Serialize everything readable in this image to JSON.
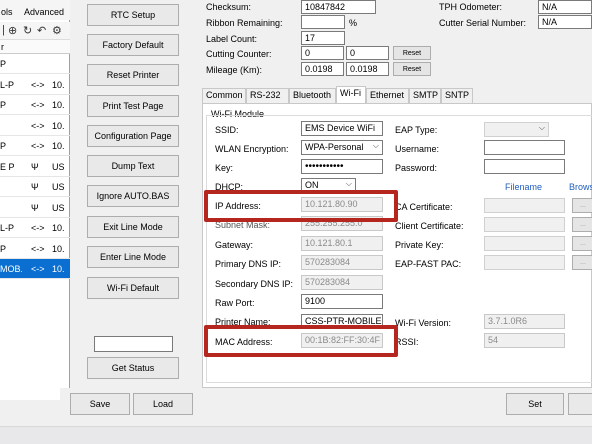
{
  "left_panel": {
    "menu": [
      "ols",
      "Advanced"
    ],
    "toolbar_icons": [
      "connect-icon",
      "refresh-icon",
      "back-icon",
      "gear-icon"
    ],
    "header": "r",
    "rows": [
      {
        "c1": "P",
        "c2": "",
        "c3": ""
      },
      {
        "c1": "L-P",
        "c2": "<->",
        "c3": "10."
      },
      {
        "c1": "P",
        "c2": "<->",
        "c3": "10."
      },
      {
        "c1": "",
        "c2": "<->",
        "c3": "10."
      },
      {
        "c1": "P",
        "c2": "<->",
        "c3": "10."
      },
      {
        "c1": "E P",
        "c2": "Ψ",
        "c3": "US"
      },
      {
        "c1": "",
        "c2": "Ψ",
        "c3": "US"
      },
      {
        "c1": "",
        "c2": "Ψ",
        "c3": "US"
      },
      {
        "c1": "L-P",
        "c2": "<->",
        "c3": "10."
      },
      {
        "c1": "P",
        "c2": "<->",
        "c3": "10."
      },
      {
        "c1": "MOB..",
        "c2": "<->",
        "c3": "10."
      }
    ],
    "selected_row": 10
  },
  "side_buttons": {
    "rtc_setup": "RTC Setup",
    "factory_default": "Factory Default",
    "reset_printer": "Reset Printer",
    "print_test_page": "Print Test Page",
    "configuration_page": "Configuration Page",
    "dump_text": "Dump Text",
    "ignore_auto_bas": "Ignore AUTO.BAS",
    "exit_line_mode": "Exit Line Mode",
    "enter_line_mode": "Enter Line Mode",
    "wifi_default": "Wi-Fi Default",
    "status_value": "",
    "get_status": "Get Status"
  },
  "info": {
    "checksum_label": "Checksum:",
    "checksum_value": "10847842",
    "ribbon_label": "Ribbon Remaining:",
    "ribbon_value": "",
    "ribbon_unit": "%",
    "label_count_label": "Label Count:",
    "label_count_value": "17",
    "cutting_label": "Cutting Counter:",
    "cutting_value1": "0",
    "cutting_value2": "0",
    "mileage_label": "Mileage (Km):",
    "mileage_value1": "0.0198",
    "mileage_value2": "0.0198",
    "reset_label": "Reset",
    "tph_label": "TPH Odometer:",
    "tph_value": "N/A",
    "cutter_serial_label": "Cutter Serial Number:",
    "cutter_serial_value": "N/A"
  },
  "tabs": [
    "Common",
    "RS-232",
    "Bluetooth",
    "Wi-Fi",
    "Ethernet",
    "SMTP",
    "SNTP"
  ],
  "active_tab": "Wi-Fi",
  "wifi": {
    "group_title": "Wi-Fi Module",
    "ssid_label": "SSID:",
    "ssid_value": "EMS Device WiFi",
    "wlan_label": "WLAN Encryption:",
    "wlan_value": "WPA-Personal",
    "key_label": "Key:",
    "key_value": "•••••••••••",
    "dhcp_label": "DHCP:",
    "dhcp_value": "ON",
    "ip_label": "IP Address:",
    "ip_value": "10.121.80.90",
    "subnet_label": "Subnet Mask:",
    "subnet_value": "255.255.255.0",
    "gateway_label": "Gateway:",
    "gateway_value": "10.121.80.1",
    "pdns_label": "Primary DNS IP:",
    "pdns_value": "570283084",
    "sdns_label": "Secondary DNS IP:",
    "sdns_value": "570283084",
    "rawport_label": "Raw Port:",
    "rawport_value": "9100",
    "printer_name_label": "Printer Name:",
    "printer_name_value": "CSS-PTR-MOBILE",
    "mac_label": "MAC Address:",
    "mac_value": "00:1B:82:FF:30:4F",
    "eap_type_label": "EAP Type:",
    "username_label": "Username:",
    "password_label": "Password:",
    "filename_header": "Filename",
    "browse_header": "Brows",
    "ca_cert_label": "CA Certificate:",
    "client_cert_label": "Client Certificate:",
    "private_key_label": "Private Key:",
    "eap_fast_label": "EAP-FAST PAC:",
    "browse_button": "...",
    "wifi_version_label": "Wi-Fi Version:",
    "wifi_version_value": "3.7.1.0R6",
    "rssi_label": "RSSI:",
    "rssi_value": "54"
  },
  "bottom": {
    "save": "Save",
    "load": "Load",
    "set": "Set"
  },
  "colors": {
    "highlight": "#b5261f",
    "selection": "#0a6fd1",
    "link_blue": "#1f5fbf"
  }
}
